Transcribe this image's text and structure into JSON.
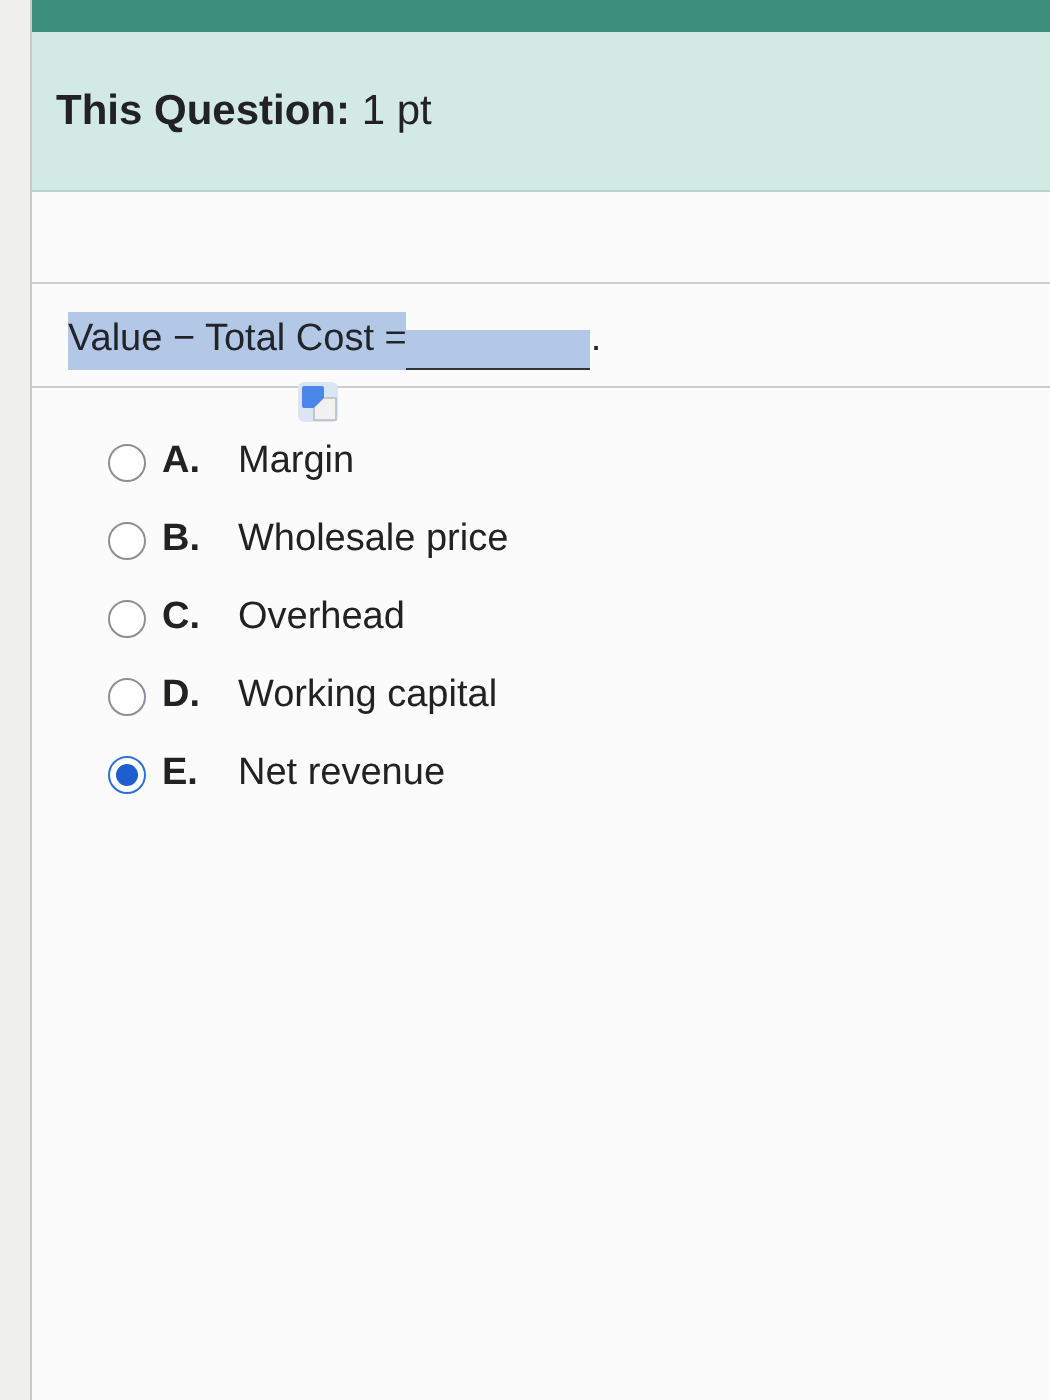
{
  "header": {
    "points_label": "This Question:",
    "points_value": "1 pt"
  },
  "question": {
    "text": "Value − Total Cost =",
    "end": "."
  },
  "options": [
    {
      "letter": "A.",
      "text": "Margin",
      "selected": false
    },
    {
      "letter": "B.",
      "text": "Wholesale price",
      "selected": false
    },
    {
      "letter": "C.",
      "text": "Overhead",
      "selected": false
    },
    {
      "letter": "D.",
      "text": "Working capital",
      "selected": false
    },
    {
      "letter": "E.",
      "text": "Net revenue",
      "selected": true
    }
  ]
}
